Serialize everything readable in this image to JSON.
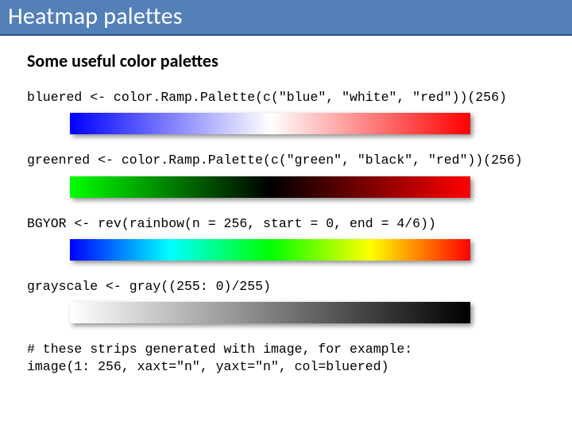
{
  "title": "Heatmap palettes",
  "subtitle": "Some useful color palettes",
  "palettes": [
    {
      "code": "bluered <- color.Ramp.Palette(c(\"blue\", \"white\", \"red\"))(256)",
      "class": "bluered"
    },
    {
      "code": "greenred <- color.Ramp.Palette(c(\"green\", \"black\", \"red\"))(256)",
      "class": "greenred"
    },
    {
      "code": "BGYOR <- rev(rainbow(n = 256, start = 0, end = 4/6))",
      "class": "bgyor"
    },
    {
      "code": "grayscale <- gray((255: 0)/255)",
      "class": "grayscale"
    }
  ],
  "footer": {
    "line1_a": "# these strips generated with ",
    "line1_b": "image",
    "line1_c": ", for example:",
    "line2": "image(1: 256, xaxt=\"n\", yaxt=\"n\", col=bluered)"
  }
}
